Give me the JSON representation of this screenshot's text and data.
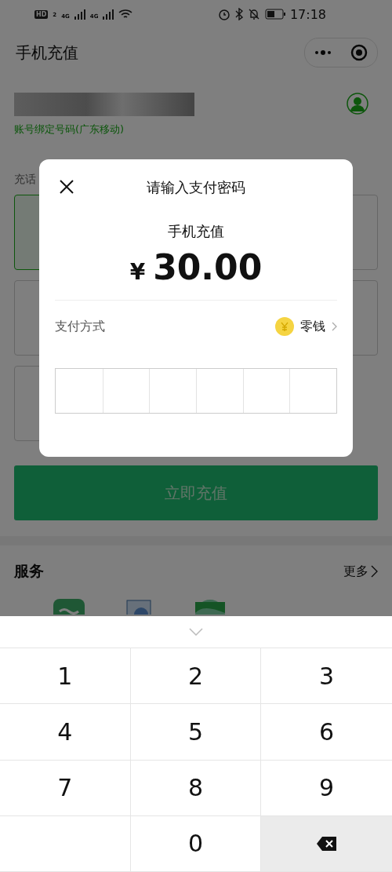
{
  "status_bar": {
    "badges": [
      "HD",
      "2"
    ],
    "networks": [
      "4G",
      "4G"
    ],
    "time": "17:18"
  },
  "header": {
    "title": "手机充值"
  },
  "account": {
    "note": "账号绑定号码(广东移动)"
  },
  "section_label": "充话",
  "cards": [
    {
      "selected": true
    },
    {
      "selected": false
    },
    {
      "selected": false
    },
    {
      "selected": false
    },
    {
      "selected": false
    }
  ],
  "recharge_button": "立即充值",
  "services": {
    "title": "服务",
    "more": "更多"
  },
  "dialog": {
    "title": "请输入支付密码",
    "item": "手机充值",
    "currency": "¥",
    "amount": "30.00",
    "method_label": "支付方式",
    "method": "零钱",
    "pin_cells": [
      {
        "filled": false
      },
      {
        "filled": false
      },
      {
        "filled": false
      },
      {
        "filled": false
      },
      {
        "filled": false
      },
      {
        "filled": false
      }
    ]
  },
  "keypad": {
    "keys": [
      {
        "kind": "digit",
        "label": "1"
      },
      {
        "kind": "digit",
        "label": "2"
      },
      {
        "kind": "digit",
        "label": "3"
      },
      {
        "kind": "digit",
        "label": "4"
      },
      {
        "kind": "digit",
        "label": "5"
      },
      {
        "kind": "digit",
        "label": "6"
      },
      {
        "kind": "digit",
        "label": "7"
      },
      {
        "kind": "digit",
        "label": "8"
      },
      {
        "kind": "digit",
        "label": "9"
      },
      {
        "kind": "blank"
      },
      {
        "kind": "digit",
        "label": "0"
      },
      {
        "kind": "backspace"
      }
    ]
  }
}
